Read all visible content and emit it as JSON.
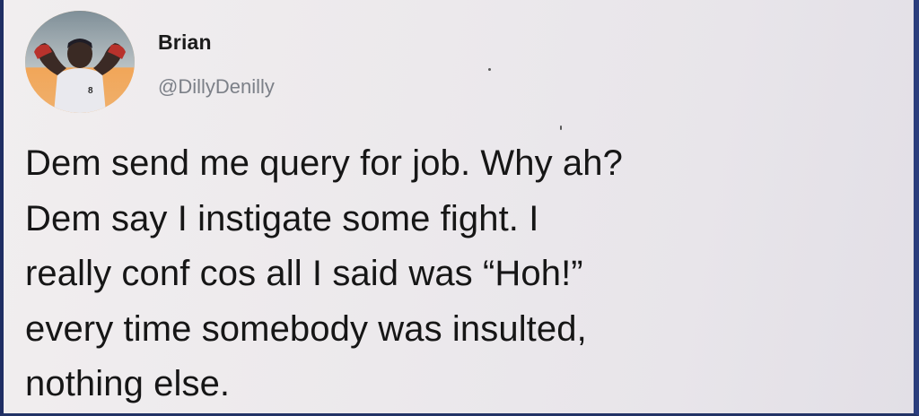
{
  "author": {
    "name": "Brian",
    "handle": "@DillyDenilly",
    "avatar": {
      "description_icon": "profile-avatar",
      "shirt_number": "8"
    }
  },
  "tweet": {
    "text": "Dem send me query for job. Why ah?\nDem say I instigate some fight. I\nreally conf cos all I said was “Hoh!”\nevery time somebody was insulted,\nnothing else."
  },
  "colors": {
    "background": "#eeebee",
    "name_text": "#1a1a1a",
    "handle_text": "#7c8088",
    "body_text": "#161616",
    "frame_border": "#2a3d7c"
  }
}
